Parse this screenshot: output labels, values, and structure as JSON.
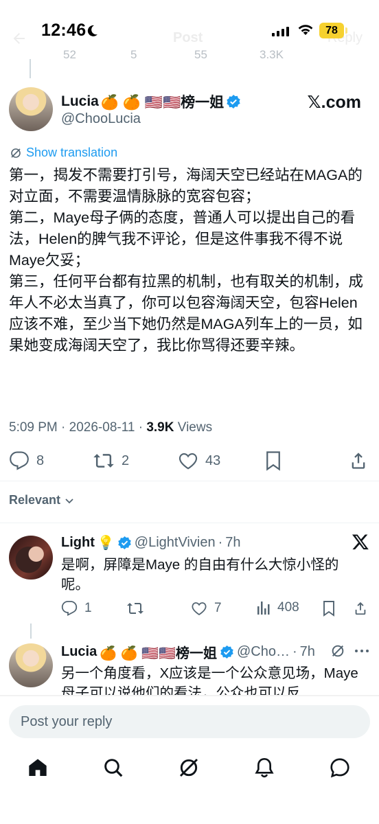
{
  "status_bar": {
    "time": "12:46",
    "battery": "78"
  },
  "ghost_header": {
    "title": "Post",
    "reply_label": "Reply"
  },
  "previous_post_actions": {
    "replies": "52",
    "reposts": "5",
    "likes": "55",
    "views": "3.3K"
  },
  "main_post": {
    "author_name": "Lucia",
    "author_badges": "🍊 🍊 🇺🇸🇺🇸榜一姐",
    "author_handle": "@ChooLucia",
    "watermark": "𝕏.com",
    "translate_label": "Show translation",
    "body": [
      "第一，揭发不需要打引号，海阔天空已经站在MAGA的对立面，不需要温情脉脉的宽容包容；",
      "第二，Maye母子俩的态度，普通人可以提出自己的看法，Helen的脾气我不评论，但是这件事我不得不说Maye欠妥；",
      "第三，任何平台都有拉黑的机制，也有取关的机制，成年人不必太当真了，你可以包容海阔天空，包容Helen应该不难，至少当下她仍然是MAGA列车上的一员，如果她变成海阔天空了，我比你骂得还要辛辣。"
    ],
    "time": "5:09 PM",
    "date": "2026-08-11",
    "views_count": "3.9K",
    "views_label": "Views",
    "replies": "8",
    "reposts": "2",
    "likes": "43"
  },
  "sort": {
    "label": "Relevant"
  },
  "replies": [
    {
      "author_name": "Light",
      "emoji": "💡",
      "author_handle": "@LightVivien",
      "age": "7h",
      "text": "是啊，屏障是Maye 的自由有什么大惊小怪的呢。",
      "replies": "1",
      "reposts": "",
      "likes": "7",
      "views": "408"
    },
    {
      "author_name": "Lucia",
      "author_badges": "🍊 🍊 🇺🇸🇺🇸榜一姐",
      "author_handle": "@Cho…",
      "age": "7h",
      "text": "另一个角度看，X应该是一个公众意见场，Maye母子可以说他们的看法，公众也可以反"
    }
  ],
  "reply_bar": {
    "placeholder": "Post your reply"
  },
  "colors": {
    "accent": "#1d9bf0",
    "text": "#0f1419",
    "muted": "#536471",
    "battery": "#f6d12f"
  }
}
